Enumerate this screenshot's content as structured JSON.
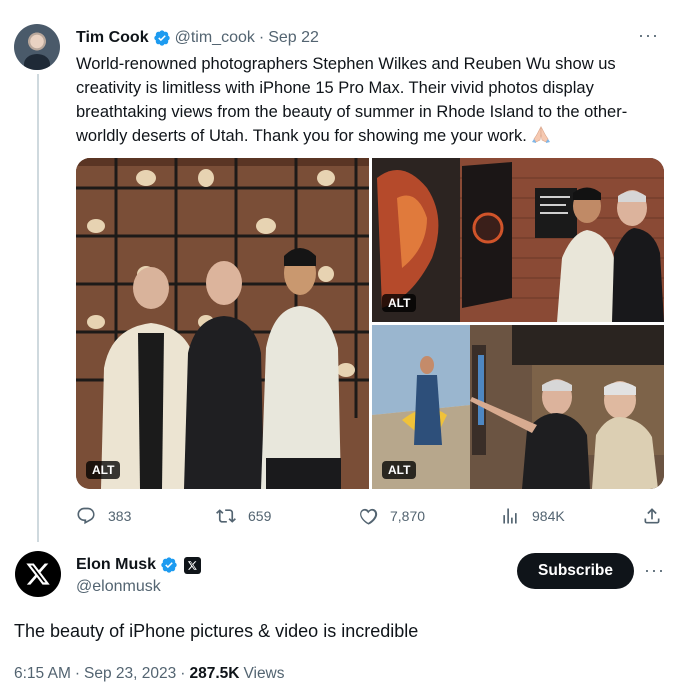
{
  "quoted_tweet": {
    "author_name": "Tim Cook",
    "handle": "@tim_cook",
    "separator": "·",
    "date": "Sep 22",
    "more_label": "···",
    "text": "World-renowned photographers Stephen Wilkes and Reuben Wu show us creativity is limitless with iPhone 15 Pro Max. Their vivid photos display breathtaking views from the beauty of summer in Rhode Island to the other-worldly deserts of Utah. Thank you for showing me your work.",
    "emoji": "folded-hands",
    "media": [
      {
        "alt_badge": "ALT",
        "subject": "three men standing in front of a brick wall with shelves"
      },
      {
        "alt_badge": "ALT",
        "subject": "men viewing large framed photographs on a brick wall"
      },
      {
        "alt_badge": "ALT",
        "subject": "men pointing at a framed beach photograph"
      }
    ],
    "actions": {
      "replies": "383",
      "reposts": "659",
      "likes": "7,870",
      "views": "984K"
    }
  },
  "tweet": {
    "author_name": "Elon Musk",
    "handle": "@elonmusk",
    "subscribe_label": "Subscribe",
    "more_label": "···",
    "text": "The beauty of iPhone pictures & video is incredible",
    "time": "6:15 AM",
    "date": "Sep 23, 2023",
    "views_count": "287.5K",
    "views_label": "Views",
    "separator": "·"
  },
  "colors": {
    "verified_blue": "#1d9bf0",
    "text": "#0f1419",
    "muted": "#536471",
    "thread_line": "#cfd9de"
  }
}
